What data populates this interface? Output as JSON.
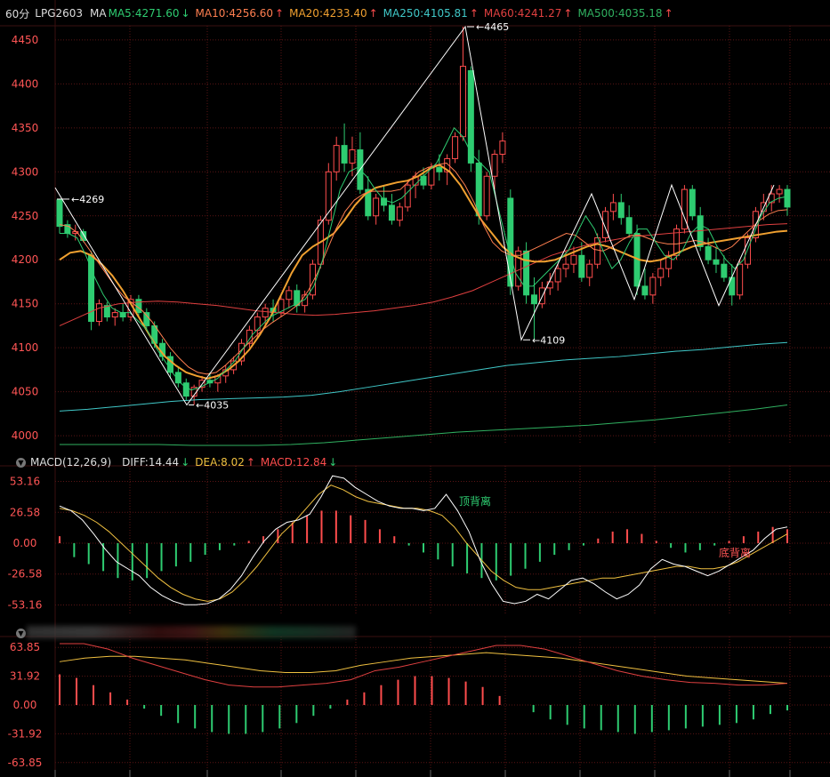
{
  "header": {
    "interval": "60分",
    "symbol": "LPG2603",
    "ma_prefix": "MA",
    "ma5": "MA5:4271.60",
    "ma10": "MA10:4256.60",
    "ma20": "MA20:4233.40",
    "ma250": "MA250:4105.81",
    "ma60": "MA60:4241.27",
    "ma500": "MA500:4035.18"
  },
  "macd_header": {
    "title": "MACD(12,26,9)",
    "diff": "DIFF:14.44",
    "dea": "DEA:8.02",
    "macd": "MACD:12.84"
  },
  "colors": {
    "up": "#ff4d4d",
    "down": "#2ecc71",
    "ma5": "#2ecc71",
    "ma10": "#ff7f50",
    "ma20": "#f0a030",
    "ma250": "#40c8c8",
    "ma60": "#e04040",
    "ma500": "#30b060",
    "grid": "#5a1515"
  },
  "chart_data": [
    {
      "type": "candlestick",
      "symbol": "LPG2603",
      "ylim": [
        3990,
        4460
      ],
      "y_ticks": [
        "4450",
        "4400",
        "4350",
        "4300",
        "4250",
        "4200",
        "4150",
        "4100",
        "4050",
        "4000"
      ],
      "annotations": [
        {
          "text": "4269",
          "label": "4269"
        },
        {
          "text": "4035",
          "label": "4035"
        },
        {
          "text": "4465",
          "label": "4465"
        },
        {
          "text": "4109",
          "label": "4109"
        }
      ],
      "candles": [
        [
          4268,
          4269,
          4230,
          4238
        ],
        [
          4240,
          4245,
          4225,
          4230
        ],
        [
          4230,
          4240,
          4222,
          4232
        ],
        [
          4232,
          4235,
          4220,
          4222
        ],
        [
          4205,
          4210,
          4120,
          4130
        ],
        [
          4130,
          4155,
          4125,
          4150
        ],
        [
          4148,
          4152,
          4130,
          4135
        ],
        [
          4135,
          4145,
          4125,
          4140
        ],
        [
          4140,
          4150,
          4130,
          4135
        ],
        [
          4135,
          4160,
          4130,
          4155
        ],
        [
          4155,
          4160,
          4135,
          4140
        ],
        [
          4140,
          4145,
          4120,
          4125
        ],
        [
          4125,
          4130,
          4100,
          4105
        ],
        [
          4105,
          4110,
          4085,
          4090
        ],
        [
          4090,
          4095,
          4065,
          4072
        ],
        [
          4072,
          4078,
          4055,
          4060
        ],
        [
          4060,
          4065,
          4040,
          4045
        ],
        [
          4045,
          4058,
          4035,
          4055
        ],
        [
          4055,
          4068,
          4050,
          4063
        ],
        [
          4063,
          4072,
          4055,
          4060
        ],
        [
          4060,
          4070,
          4050,
          4068
        ],
        [
          4068,
          4080,
          4060,
          4075
        ],
        [
          4075,
          4090,
          4070,
          4085
        ],
        [
          4085,
          4110,
          4080,
          4105
        ],
        [
          4105,
          4125,
          4100,
          4120
        ],
        [
          4120,
          4140,
          4110,
          4135
        ],
        [
          4135,
          4150,
          4125,
          4145
        ],
        [
          4145,
          4155,
          4130,
          4140
        ],
        [
          4140,
          4160,
          4135,
          4155
        ],
        [
          4155,
          4170,
          4145,
          4165
        ],
        [
          4165,
          4172,
          4140,
          4148
        ],
        [
          4148,
          4165,
          4140,
          4160
        ],
        [
          4160,
          4200,
          4155,
          4195
        ],
        [
          4195,
          4250,
          4190,
          4245
        ],
        [
          4245,
          4310,
          4240,
          4300
        ],
        [
          4300,
          4340,
          4290,
          4330
        ],
        [
          4330,
          4355,
          4300,
          4310
        ],
        [
          4310,
          4340,
          4295,
          4325
        ],
        [
          4325,
          4345,
          4275,
          4280
        ],
        [
          4280,
          4295,
          4245,
          4250
        ],
        [
          4250,
          4275,
          4240,
          4270
        ],
        [
          4270,
          4285,
          4255,
          4262
        ],
        [
          4262,
          4275,
          4240,
          4245
        ],
        [
          4245,
          4265,
          4238,
          4260
        ],
        [
          4260,
          4290,
          4255,
          4285
        ],
        [
          4285,
          4300,
          4270,
          4295
        ],
        [
          4295,
          4305,
          4280,
          4285
        ],
        [
          4285,
          4310,
          4280,
          4305
        ],
        [
          4305,
          4320,
          4290,
          4300
        ],
        [
          4300,
          4320,
          4285,
          4315
        ],
        [
          4315,
          4345,
          4310,
          4340
        ],
        [
          4340,
          4465,
          4335,
          4420
        ],
        [
          4415,
          4420,
          4300,
          4310
        ],
        [
          4310,
          4325,
          4240,
          4250
        ],
        [
          4250,
          4300,
          4245,
          4295
        ],
        [
          4295,
          4325,
          4280,
          4320
        ],
        [
          4320,
          4345,
          4310,
          4335
        ],
        [
          4270,
          4280,
          4160,
          4170
        ],
        [
          4170,
          4215,
          4165,
          4210
        ],
        [
          4210,
          4220,
          4150,
          4160
        ],
        [
          4160,
          4180,
          4109,
          4150
        ],
        [
          4150,
          4175,
          4145,
          4168
        ],
        [
          4168,
          4185,
          4160,
          4175
        ],
        [
          4175,
          4195,
          4165,
          4190
        ],
        [
          4190,
          4210,
          4180,
          4195
        ],
        [
          4195,
          4215,
          4185,
          4205
        ],
        [
          4205,
          4220,
          4175,
          4180
        ],
        [
          4180,
          4200,
          4170,
          4195
        ],
        [
          4195,
          4230,
          4190,
          4225
        ],
        [
          4225,
          4260,
          4220,
          4255
        ],
        [
          4255,
          4275,
          4245,
          4265
        ],
        [
          4265,
          4275,
          4240,
          4248
        ],
        [
          4248,
          4262,
          4225,
          4230
        ],
        [
          4230,
          4240,
          4160,
          4170
        ],
        [
          4170,
          4190,
          4155,
          4160
        ],
        [
          4160,
          4185,
          4150,
          4180
        ],
        [
          4180,
          4200,
          4170,
          4190
        ],
        [
          4190,
          4210,
          4180,
          4205
        ],
        [
          4205,
          4240,
          4200,
          4235
        ],
        [
          4235,
          4285,
          4230,
          4280
        ],
        [
          4280,
          4285,
          4245,
          4250
        ],
        [
          4250,
          4260,
          4210,
          4215
        ],
        [
          4215,
          4225,
          4195,
          4200
        ],
        [
          4200,
          4215,
          4185,
          4195
        ],
        [
          4195,
          4205,
          4175,
          4180
        ],
        [
          4180,
          4195,
          4148,
          4160
        ],
        [
          4160,
          4200,
          4155,
          4195
        ],
        [
          4195,
          4230,
          4190,
          4225
        ],
        [
          4225,
          4260,
          4220,
          4255
        ],
        [
          4255,
          4275,
          4245,
          4265
        ],
        [
          4265,
          4285,
          4255,
          4275
        ],
        [
          4275,
          4285,
          4265,
          4280
        ],
        [
          4280,
          4285,
          4250,
          4260
        ]
      ],
      "ma5": [
        4230,
        4230,
        4225,
        4205,
        4180,
        4160,
        4145,
        4140,
        4140,
        4130,
        4120,
        4100,
        4085,
        4070,
        4058,
        4052,
        4055,
        4060,
        4065,
        4075,
        4085,
        4100,
        4115,
        4125,
        4135,
        4140,
        4145,
        4150,
        4155,
        4170,
        4200,
        4240,
        4280,
        4300,
        4305,
        4295,
        4280,
        4268,
        4265,
        4270,
        4280,
        4290,
        4300,
        4310,
        4330,
        4350,
        4340,
        4320,
        4310,
        4300,
        4260,
        4220,
        4185,
        4170,
        4170,
        4180,
        4190,
        4200,
        4210,
        4230,
        4250,
        4235,
        4210,
        4190,
        4200,
        4220,
        4235,
        4235,
        4220,
        4205,
        4200,
        4210,
        4230,
        4240,
        4235,
        4215,
        4200,
        4190,
        4200,
        4225,
        4250,
        4265,
        4270,
        4272
      ],
      "ma10": [
        4240,
        4238,
        4230,
        4215,
        4200,
        4185,
        4170,
        4158,
        4150,
        4142,
        4130,
        4115,
        4100,
        4088,
        4078,
        4072,
        4070,
        4072,
        4080,
        4090,
        4100,
        4110,
        4120,
        4128,
        4135,
        4142,
        4150,
        4165,
        4185,
        4210,
        4235,
        4255,
        4268,
        4275,
        4278,
        4278,
        4278,
        4280,
        4290,
        4300,
        4305,
        4308,
        4310,
        4300,
        4285,
        4265,
        4240,
        4220,
        4210,
        4205,
        4205,
        4210,
        4215,
        4220,
        4225,
        4230,
        4228,
        4220,
        4212,
        4210,
        4215,
        4222,
        4228,
        4228,
        4224,
        4220,
        4218,
        4218,
        4220,
        4222,
        4220,
        4215,
        4210,
        4215,
        4225,
        4235,
        4245,
        4252,
        4256,
        4257
      ],
      "ma20": [
        4200,
        4208,
        4210,
        4205,
        4195,
        4182,
        4165,
        4145,
        4125,
        4105,
        4090,
        4080,
        4072,
        4068,
        4065,
        4068,
        4075,
        4085,
        4098,
        4115,
        4135,
        4160,
        4185,
        4205,
        4215,
        4222,
        4230,
        4245,
        4262,
        4275,
        4282,
        4285,
        4288,
        4290,
        4295,
        4303,
        4308,
        4300,
        4285,
        4265,
        4245,
        4230,
        4215,
        4205,
        4200,
        4198,
        4198,
        4200,
        4205,
        4210,
        4215,
        4218,
        4215,
        4210,
        4205,
        4200,
        4198,
        4200,
        4205,
        4210,
        4215,
        4218,
        4220,
        4222,
        4224,
        4226,
        4228,
        4230,
        4232,
        4233
      ],
      "ma60": [
        4125,
        4135,
        4145,
        4150,
        4152,
        4153,
        4152,
        4150,
        4148,
        4145,
        4142,
        4140,
        4138,
        4137,
        4138,
        4140,
        4142,
        4145,
        4148,
        4152,
        4158,
        4165,
        4175,
        4185,
        4195,
        4205,
        4212,
        4218,
        4222,
        4226,
        4228,
        4230,
        4232,
        4234,
        4236,
        4238,
        4240,
        4241
      ],
      "ma250": [
        4028,
        4030,
        4033,
        4036,
        4039,
        4041,
        4042,
        4043,
        4044,
        4046,
        4050,
        4055,
        4060,
        4065,
        4070,
        4075,
        4080,
        4083,
        4086,
        4088,
        4090,
        4093,
        4096,
        4098,
        4101,
        4104,
        4106
      ],
      "ma500": [
        3990,
        3990,
        3990,
        3990,
        3989,
        3989,
        3989,
        3990,
        3992,
        3995,
        3998,
        4001,
        4004,
        4006,
        4008,
        4010,
        4012,
        4015,
        4018,
        4022,
        4026,
        4030,
        4035
      ]
    },
    {
      "type": "line",
      "name": "MACD(12,26,9)",
      "y_ticks": [
        "53.16",
        "26.58",
        "0.00",
        "-26.58",
        "-53.16"
      ],
      "ylim": [
        -62,
        62
      ],
      "annotations": [
        "顶背离",
        "底背离"
      ],
      "diff": [
        32,
        28,
        20,
        8,
        -5,
        -16,
        -22,
        -28,
        -38,
        -45,
        -50,
        -53,
        -53,
        -52,
        -48,
        -40,
        -28,
        -12,
        2,
        12,
        18,
        20,
        25,
        40,
        58,
        56,
        48,
        42,
        36,
        32,
        30,
        30,
        28,
        30,
        42,
        28,
        10,
        -15,
        -35,
        -50,
        -52,
        -50,
        -44,
        -48,
        -40,
        -32,
        -30,
        -35,
        -42,
        -48,
        -44,
        -36,
        -22,
        -14,
        -18,
        -20,
        -24,
        -28,
        -24,
        -18,
        -12,
        -6,
        4,
        12,
        14
      ],
      "dea": [
        30,
        28,
        24,
        18,
        10,
        0,
        -10,
        -20,
        -30,
        -38,
        -44,
        -48,
        -50,
        -48,
        -42,
        -32,
        -20,
        -6,
        8,
        18,
        30,
        42,
        50,
        46,
        40,
        36,
        34,
        32,
        30,
        30,
        28,
        24,
        14,
        0,
        -12,
        -24,
        -32,
        -38,
        -40,
        -40,
        -38,
        -36,
        -34,
        -32,
        -30,
        -30,
        -28,
        -26,
        -24,
        -22,
        -20,
        -20,
        -22,
        -22,
        -20,
        -16,
        -10,
        -4,
        2,
        8
      ],
      "hist": [
        6,
        -12,
        -18,
        -24,
        -30,
        -32,
        -30,
        -24,
        -20,
        -16,
        -10,
        -6,
        -2,
        2,
        6,
        12,
        18,
        24,
        28,
        28,
        24,
        20,
        12,
        6,
        -2,
        -8,
        -14,
        -20,
        -26,
        -30,
        -32,
        -28,
        -22,
        -16,
        -10,
        -6,
        -2,
        4,
        10,
        12,
        8,
        2,
        -4,
        -8,
        -6,
        -2,
        2,
        6,
        10,
        14,
        12
      ]
    },
    {
      "type": "line",
      "y_ticks": [
        "63.85",
        "31.92",
        "0.00",
        "-31.92",
        "-63.85"
      ],
      "ylim": [
        -70,
        70
      ],
      "line_a": [
        68,
        68,
        62,
        52,
        44,
        36,
        28,
        22,
        20,
        20,
        22,
        24,
        28,
        38,
        42,
        48,
        54,
        60,
        66,
        66,
        62,
        54,
        46,
        38,
        32,
        28,
        25,
        24,
        22,
        22,
        24
      ],
      "line_b": [
        48,
        52,
        54,
        54,
        52,
        50,
        46,
        42,
        38,
        36,
        36,
        38,
        44,
        48,
        52,
        54,
        56,
        58,
        56,
        54,
        52,
        48,
        44,
        40,
        36,
        32,
        30,
        28,
        26,
        24
      ],
      "hist": [
        34,
        30,
        22,
        14,
        6,
        -4,
        -12,
        -20,
        -26,
        -30,
        -32,
        -32,
        -30,
        -26,
        -20,
        -12,
        -4,
        6,
        14,
        22,
        28,
        32,
        32,
        30,
        26,
        20,
        10,
        0,
        -8,
        -16,
        -22,
        -26,
        -28,
        -30,
        -32,
        -30,
        -28,
        -26,
        -24,
        -22,
        -20,
        -16,
        -10,
        -6
      ]
    }
  ]
}
